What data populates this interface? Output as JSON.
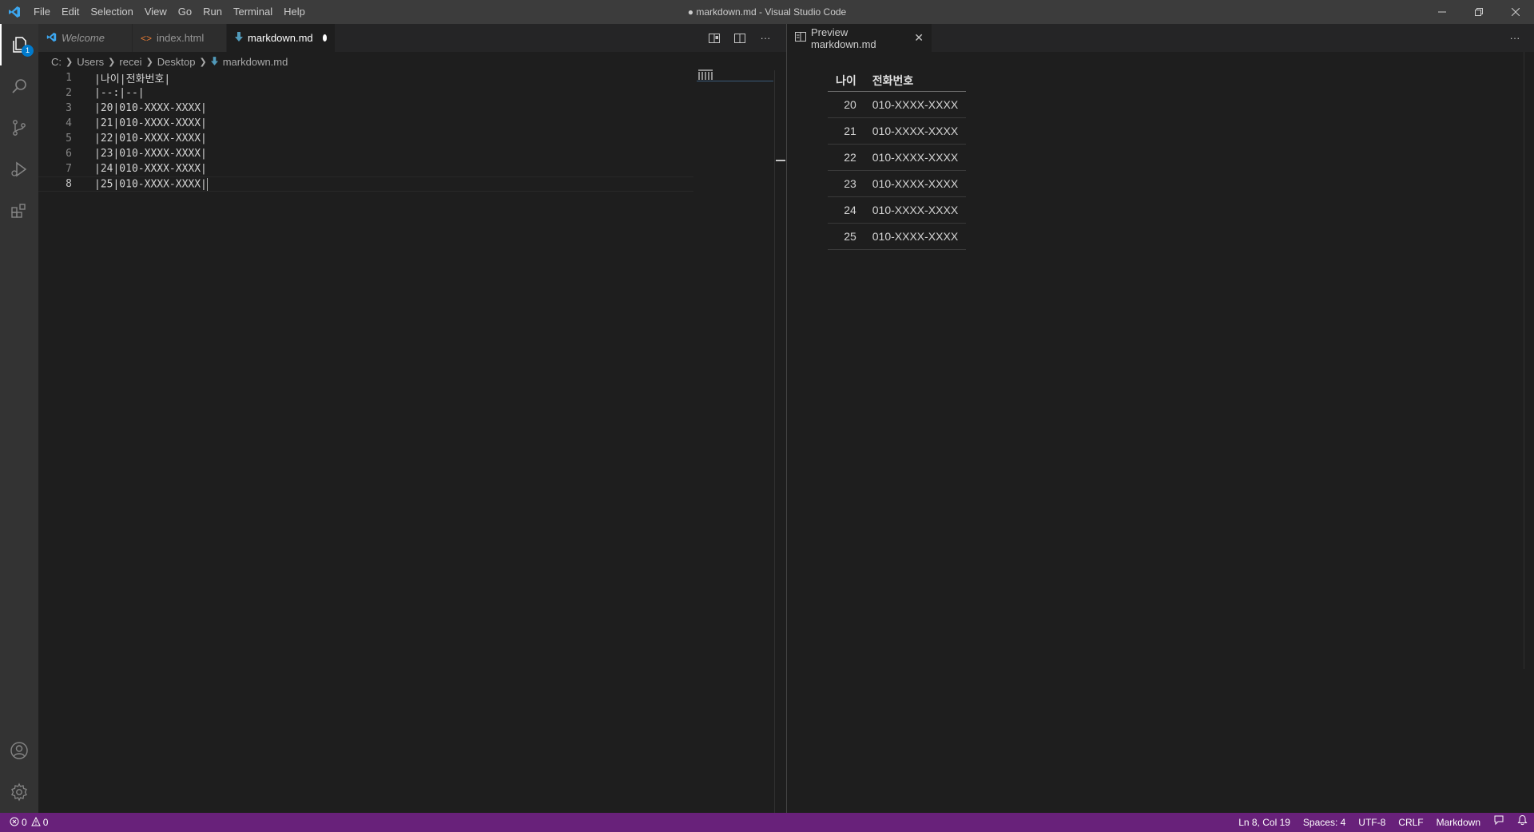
{
  "window": {
    "title": "● markdown.md - Visual Studio Code"
  },
  "menu": [
    "File",
    "Edit",
    "Selection",
    "View",
    "Go",
    "Run",
    "Terminal",
    "Help"
  ],
  "activity_bar": {
    "explorer_badge": "1"
  },
  "left_tabs": [
    {
      "label": "Welcome",
      "icon": "vscode-logo-icon"
    },
    {
      "label": "index.html",
      "icon": "html-file-icon"
    },
    {
      "label": "markdown.md",
      "icon": "markdown-file-icon",
      "dirty": true
    }
  ],
  "breadcrumb": [
    "C:",
    "Users",
    "recei",
    "Desktop",
    "markdown.md"
  ],
  "editor": {
    "lines": [
      {
        "num": "1",
        "text": "|나이|전화번호|"
      },
      {
        "num": "2",
        "text": "|--:|--|"
      },
      {
        "num": "3",
        "text": "|20|010-XXXX-XXXX|"
      },
      {
        "num": "4",
        "text": "|21|010-XXXX-XXXX|"
      },
      {
        "num": "5",
        "text": "|22|010-XXXX-XXXX|"
      },
      {
        "num": "6",
        "text": "|23|010-XXXX-XXXX|"
      },
      {
        "num": "7",
        "text": "|24|010-XXXX-XXXX|"
      },
      {
        "num": "8",
        "text": "|25|010-XXXX-XXXX|"
      }
    ]
  },
  "preview": {
    "tab_label": "Preview markdown.md",
    "table": {
      "headers": [
        "나이",
        "전화번호"
      ],
      "rows": [
        [
          "20",
          "010-XXXX-XXXX"
        ],
        [
          "21",
          "010-XXXX-XXXX"
        ],
        [
          "22",
          "010-XXXX-XXXX"
        ],
        [
          "23",
          "010-XXXX-XXXX"
        ],
        [
          "24",
          "010-XXXX-XXXX"
        ],
        [
          "25",
          "010-XXXX-XXXX"
        ]
      ]
    }
  },
  "status": {
    "errors": "0",
    "warnings": "0",
    "position": "Ln 8, Col 19",
    "spaces": "Spaces: 4",
    "encoding": "UTF-8",
    "eol": "CRLF",
    "language": "Markdown"
  },
  "colors": {
    "statusbar": "#68217a",
    "accent": "#007acc"
  }
}
